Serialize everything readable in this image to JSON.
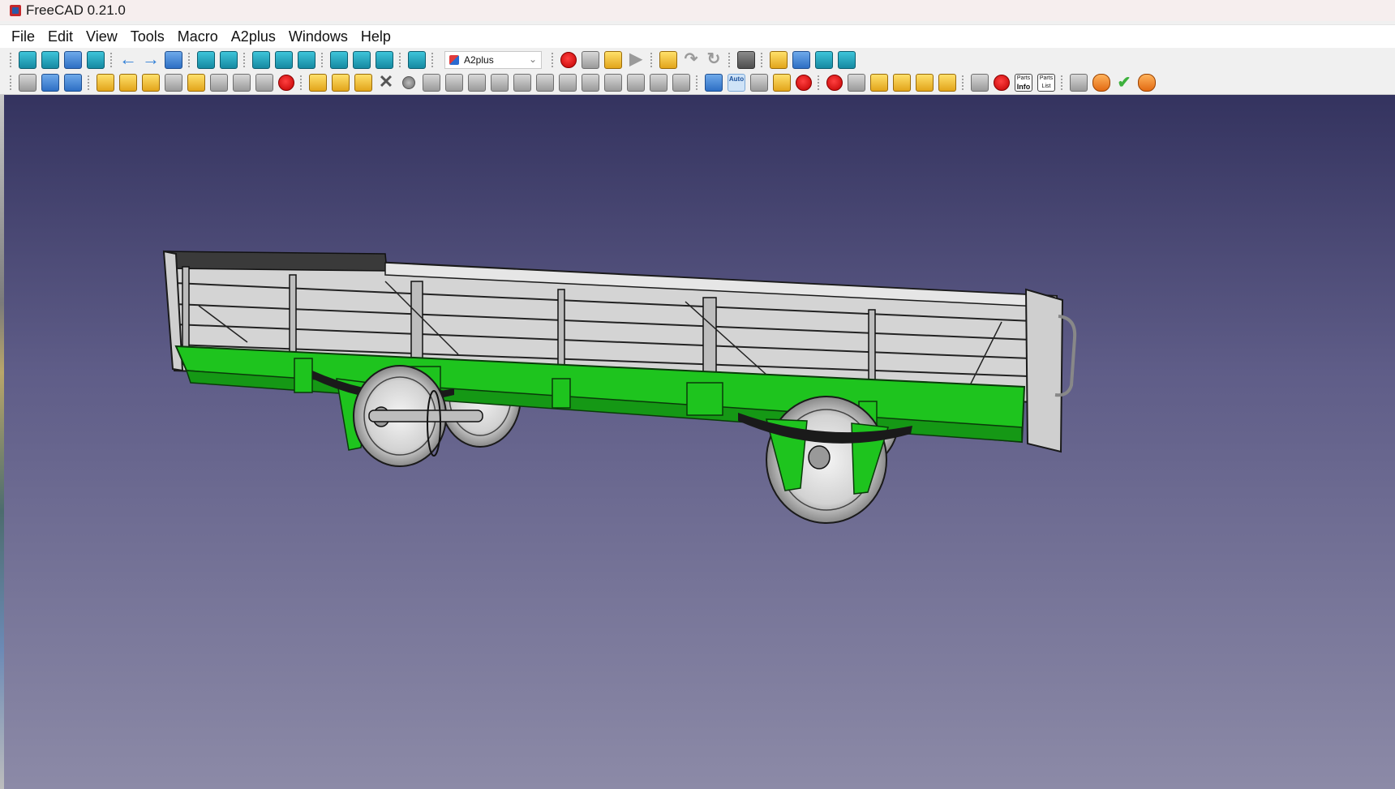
{
  "window": {
    "title": "FreeCAD 0.21.0",
    "app_icon": "freecad-icon"
  },
  "menubar": {
    "items": [
      "File",
      "Edit",
      "View",
      "Tools",
      "Macro",
      "A2plus",
      "Windows",
      "Help"
    ]
  },
  "toolbar1": {
    "workbench_selector": {
      "value": "A2plus",
      "icon": "a2plus-workbench-icon"
    },
    "icons": [
      "fit-all-icon",
      "fit-selection-icon",
      "draw-style-icon",
      "bounding-box-icon",
      "back-arrow-icon",
      "forward-arrow-icon",
      "workbench-icon",
      "zoom-icon",
      "isometric-view-icon",
      "front-view-icon",
      "top-view-icon",
      "right-view-icon",
      "rear-view-icon",
      "bottom-view-icon",
      "left-view-icon",
      "measure-icon",
      "record-macro-icon",
      "stop-macro-icon",
      "edit-macro-icon",
      "run-macro-icon",
      "undo-icon",
      "redo-icon",
      "refresh-icon",
      "whats-this-icon",
      "part-icon",
      "open-folder-icon",
      "export-icon",
      "import-icon"
    ]
  },
  "toolbar2": {
    "icons": [
      "new-document-icon",
      "open-document-icon",
      "save-document-icon",
      "add-part-icon",
      "add-part-from-library-icon",
      "import-part-icon",
      "update-parts-icon",
      "duplicate-part-icon",
      "convert-part-icon",
      "edit-part-icon",
      "show-part-icon",
      "constraint-add-icon",
      "constraint-delete-icon",
      "constraint-edit-icon",
      "delete-constraint-icon",
      "point-identity-icon",
      "point-on-line-icon",
      "point-on-plane-icon",
      "sphere-center-icon",
      "circular-edge-icon",
      "axis-coincident-icon",
      "axis-parallel-icon",
      "axis-plane-parallel-icon",
      "axis-plane-normal-icon",
      "plane-parallel-icon",
      "plane-coincident-icon",
      "angled-planes-icon",
      "center-of-mass-icon",
      "solve-icon",
      "auto-solve-icon",
      "flip-direction-icon",
      "constraint-viewer-icon",
      "part-list-icon",
      "move-part-icon",
      "search-icon",
      "shape-explorer-icon",
      "settings-icon",
      "tag-icon",
      "selection-icon",
      "delete-icon",
      "tree-view-icon",
      "parts-info-icon",
      "parts-list-icon",
      "lamp-icon",
      "recompute-icon",
      "check-icon",
      "eraser-icon"
    ],
    "auto_label": "Auto",
    "parts_info": {
      "line1": "Parts",
      "line2": "Info"
    },
    "parts_list": {
      "line1": "Parts",
      "line2": "List"
    }
  },
  "viewport": {
    "model": "railway-wagon-assembly",
    "colors": {
      "background_top": "#34335f",
      "background_bottom": "#8c8aa7",
      "body": "#d6d6d6",
      "frame": "#1fc31f",
      "outline": "#1a1a1a"
    }
  }
}
